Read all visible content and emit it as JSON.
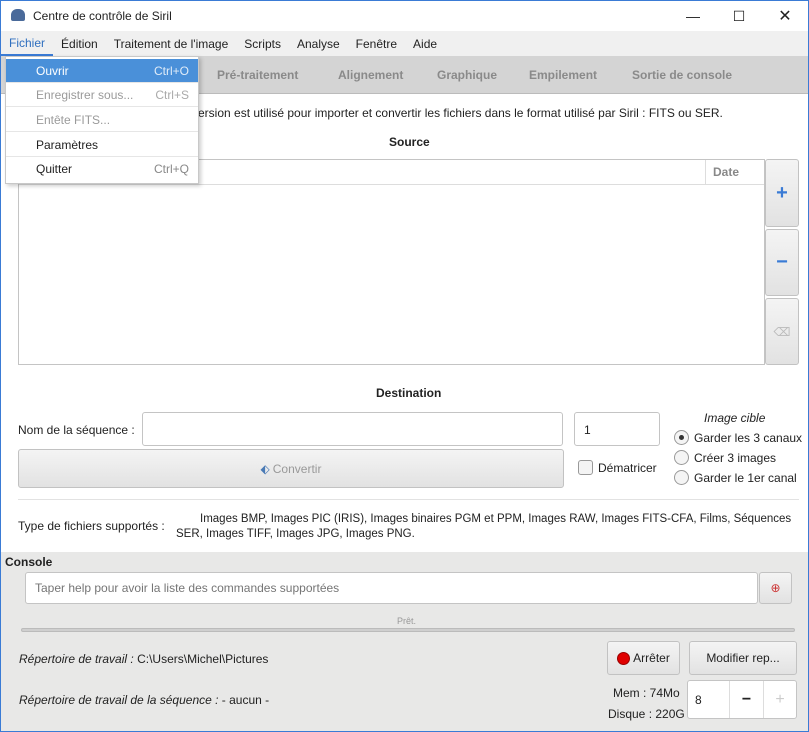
{
  "window": {
    "title": "Centre de contrôle de Siril"
  },
  "menubar": [
    "Fichier",
    "Édition",
    "Traitement de l'image",
    "Scripts",
    "Analyse",
    "Fenêtre",
    "Aide"
  ],
  "file_menu": [
    {
      "label": "Ouvrir",
      "shortcut": "Ctrl+O",
      "state": "highlighted"
    },
    {
      "label": "Enregistrer sous...",
      "shortcut": "Ctrl+S",
      "state": "disabled"
    },
    {
      "label": "Entête FITS...",
      "shortcut": "",
      "state": "disabled"
    },
    {
      "label": "Paramètres",
      "shortcut": "",
      "state": "enabled"
    },
    {
      "label": "Quitter",
      "shortcut": "Ctrl+Q",
      "state": "enabled"
    }
  ],
  "tabs": [
    "Pré-traitement",
    "Alignement",
    "Graphique",
    "Empilement",
    "Sortie de console"
  ],
  "conversion": {
    "description": "ersion est utilisé pour importer et convertir les fichiers dans le format utilisé par Siril : FITS ou SER.",
    "source_title": "Source",
    "date_col": "Date",
    "destination_title": "Destination",
    "seq_label": "Nom de la séquence :",
    "seq_value": "",
    "start_index": "1",
    "convert_label": "Convertir",
    "debayer_label": "Dématricer",
    "debayer_checked": false,
    "target_title": "Image cible",
    "target_options": [
      {
        "label": "Garder les 3 canaux",
        "selected": true
      },
      {
        "label": "Créer 3 images",
        "selected": false
      },
      {
        "label": "Garder le 1er canal",
        "selected": false
      }
    ],
    "supported_label": "Type de fichiers supportés :",
    "supported_line1": "Images BMP, Images PIC (IRIS), Images binaires PGM et PPM, Images RAW, Images FITS-CFA, Films, Séquences",
    "supported_line2": "SER, Images TIFF, Images JPG, Images PNG."
  },
  "console": {
    "title": "Console",
    "placeholder": "Taper help pour avoir la liste des commandes supportées",
    "status": "Prêt.",
    "progress": 0
  },
  "footer": {
    "workdir_label": "Répertoire de travail :",
    "workdir_value": " C:\\Users\\Michel\\Pictures",
    "seqdir_label": "Répertoire de travail de la séquence :",
    "seqdir_value": " - aucun -",
    "stop_label": "Arrêter",
    "modify_label": "Modifier rep...",
    "mem": "Mem : 74Mo",
    "disk": "Disque : 220G",
    "threads": "8"
  },
  "colors": {
    "accent": "#4a90d9",
    "stop": "#e00000"
  }
}
